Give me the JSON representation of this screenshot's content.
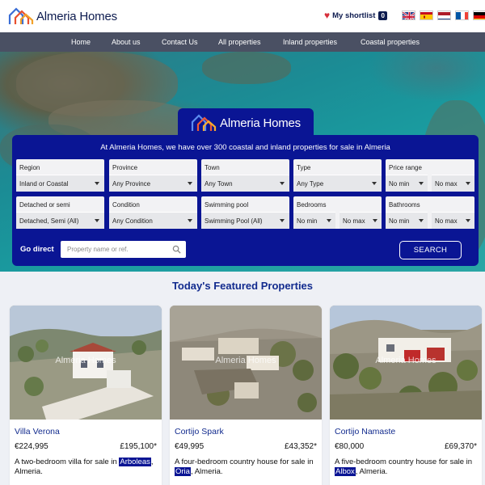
{
  "header": {
    "logo_text": "Almeria Homes",
    "shortlist_label": "My shortlist",
    "shortlist_count": "0",
    "languages": [
      "English",
      "Spanish",
      "Dutch",
      "French",
      "German"
    ]
  },
  "nav": {
    "items": [
      "Home",
      "About us",
      "Contact Us",
      "All properties",
      "Inland properties",
      "Coastal properties"
    ]
  },
  "search": {
    "logo_text": "Almeria Homes",
    "tagline": "At Almeria Homes, we have over 300 coastal and inland properties for sale in Almeria",
    "fields": {
      "region": {
        "label": "Region",
        "value": "Inland or Coastal"
      },
      "province": {
        "label": "Province",
        "value": "Any Province"
      },
      "town": {
        "label": "Town",
        "value": "Any Town"
      },
      "type": {
        "label": "Type",
        "value": "Any Type"
      },
      "price": {
        "label": "Price range",
        "min": "No min",
        "max": "No max"
      },
      "detached": {
        "label": "Detached or semi",
        "value": "Detached, Semi (All)"
      },
      "condition": {
        "label": "Condition",
        "value": "Any Condition"
      },
      "pool": {
        "label": "Swimming pool",
        "value": "Swimming Pool (All)"
      },
      "bedrooms": {
        "label": "Bedrooms",
        "min": "No min",
        "max": "No max"
      },
      "bathrooms": {
        "label": "Bathrooms",
        "min": "No min",
        "max": "No max"
      }
    },
    "go_direct_label": "Go direct",
    "go_direct_placeholder": "Property name or ref.",
    "search_button": "SEARCH"
  },
  "featured": {
    "title": "Today's Featured Properties",
    "watermark": "Almeria Homes",
    "cards": [
      {
        "name": "Villa Verona",
        "price_eur": "€224,995",
        "price_gbp": "£195,100*",
        "desc_before": "A two-bedroom villa for sale in ",
        "town": "Arboleas",
        "desc_after": ", Almeria."
      },
      {
        "name": "Cortijo Spark",
        "price_eur": "€49,995",
        "price_gbp": "£43,352*",
        "desc_before": "A four-bedroom country house for sale in ",
        "town": "Oria",
        "desc_after": ", Almeria."
      },
      {
        "name": "Cortijo Namaste",
        "price_eur": "€80,000",
        "price_gbp": "£69,370*",
        "desc_before": "A five-bedroom country house for sale in ",
        "town": "Albox",
        "desc_after": ", Almeria."
      }
    ]
  },
  "colors": {
    "brand_blue": "#0a1594",
    "nav_bg": "#4a5063",
    "title_blue": "#122b8e",
    "heart_red": "#d62f3b"
  }
}
